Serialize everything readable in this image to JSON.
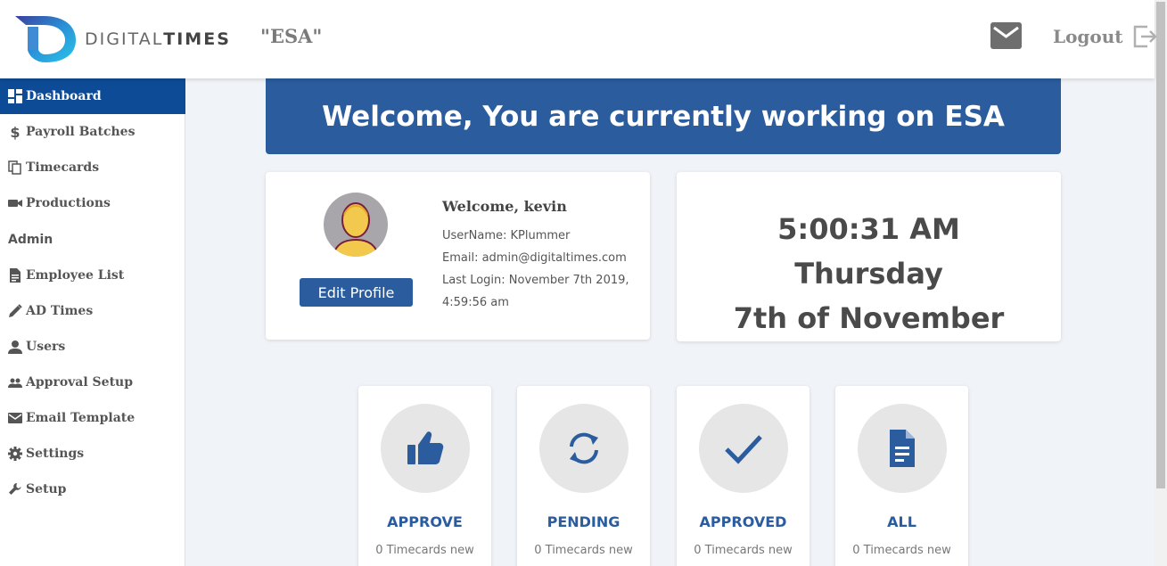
{
  "header": {
    "logo_text_regular": "DIGITAL",
    "logo_text_bold": "TIMES",
    "client": "\"ESA\"",
    "logout_label": "Logout"
  },
  "sidebar": {
    "items": [
      {
        "label": "Dashboard",
        "icon": "dashboard-icon",
        "active": true
      },
      {
        "label": "Payroll Batches",
        "icon": "dollar-icon"
      },
      {
        "label": "Timecards",
        "icon": "copy-icon"
      },
      {
        "label": "Productions",
        "icon": "video-camera-icon"
      }
    ],
    "section_admin": "Admin",
    "admin_items": [
      {
        "label": "Employee List",
        "icon": "document-icon"
      },
      {
        "label": "AD Times",
        "icon": "pencil-icon"
      },
      {
        "label": "Users",
        "icon": "person-icon"
      },
      {
        "label": "Approval Setup",
        "icon": "people-icon"
      },
      {
        "label": "Email Template",
        "icon": "envelope-icon"
      },
      {
        "label": "Settings",
        "icon": "gear-icon"
      },
      {
        "label": "Setup",
        "icon": "wrench-icon"
      }
    ]
  },
  "banner": {
    "text": "Welcome, You are currently working on ESA"
  },
  "profile": {
    "welcome": "Welcome, kevin",
    "username": "UserName: KPlummer",
    "email": "Email: admin@digitaltimes.com",
    "last_login_1": "Last Login: November 7th 2019,",
    "last_login_2": "4:59:56 am",
    "edit_button": "Edit Profile"
  },
  "clock": {
    "time": "5:00:31 AM",
    "day": "Thursday",
    "date": "7th of November"
  },
  "stats": [
    {
      "title": "APPROVE",
      "sub": "0 Timecards new",
      "icon": "thumbs-up-icon"
    },
    {
      "title": "PENDING",
      "sub": "0 Timecards new",
      "icon": "sync-icon"
    },
    {
      "title": "APPROVED",
      "sub": "0 Timecards new",
      "icon": "checkmark-icon"
    },
    {
      "title": "ALL",
      "sub": "0 Timecards new",
      "icon": "file-icon"
    }
  ],
  "colors": {
    "primary": "#2b5c9e",
    "active_nav": "#0d4b96",
    "background": "#f0f3f7"
  }
}
